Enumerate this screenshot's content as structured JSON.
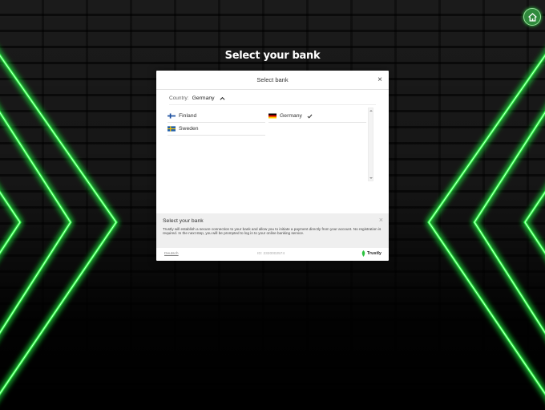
{
  "page": {
    "title": "Select your bank"
  },
  "modal": {
    "header_title": "Select bank",
    "close_glyph": "×",
    "country_label": "Country:",
    "country_value": "Germany",
    "countries": [
      {
        "name": "Finland",
        "flag": "finland-flag",
        "selected": false
      },
      {
        "name": "Germany",
        "flag": "germany-flag",
        "selected": true
      },
      {
        "name": "Sweden",
        "flag": "sweden-flag",
        "selected": false
      }
    ],
    "info": {
      "title": "Select your bank",
      "text": "Trustly will establish a secure connection to your bank and allow you to initiate a payment directly from your account. No registration is required. In the next step, you will be prompted to log in to your online banking service.",
      "close_glyph": "×"
    },
    "footer": {
      "language_link": "Deutsch",
      "id_text": "ID: 2320002574",
      "brand": "Trustly"
    }
  },
  "colors": {
    "neon_green": "#2cff46",
    "home_button": "#2f8a3c",
    "check": "#333333"
  },
  "icons": {
    "home": "home-icon",
    "close": "close-icon",
    "chevron": "chevron-up-icon",
    "check": "checkmark-icon",
    "brand": "trustly-logo-icon"
  }
}
